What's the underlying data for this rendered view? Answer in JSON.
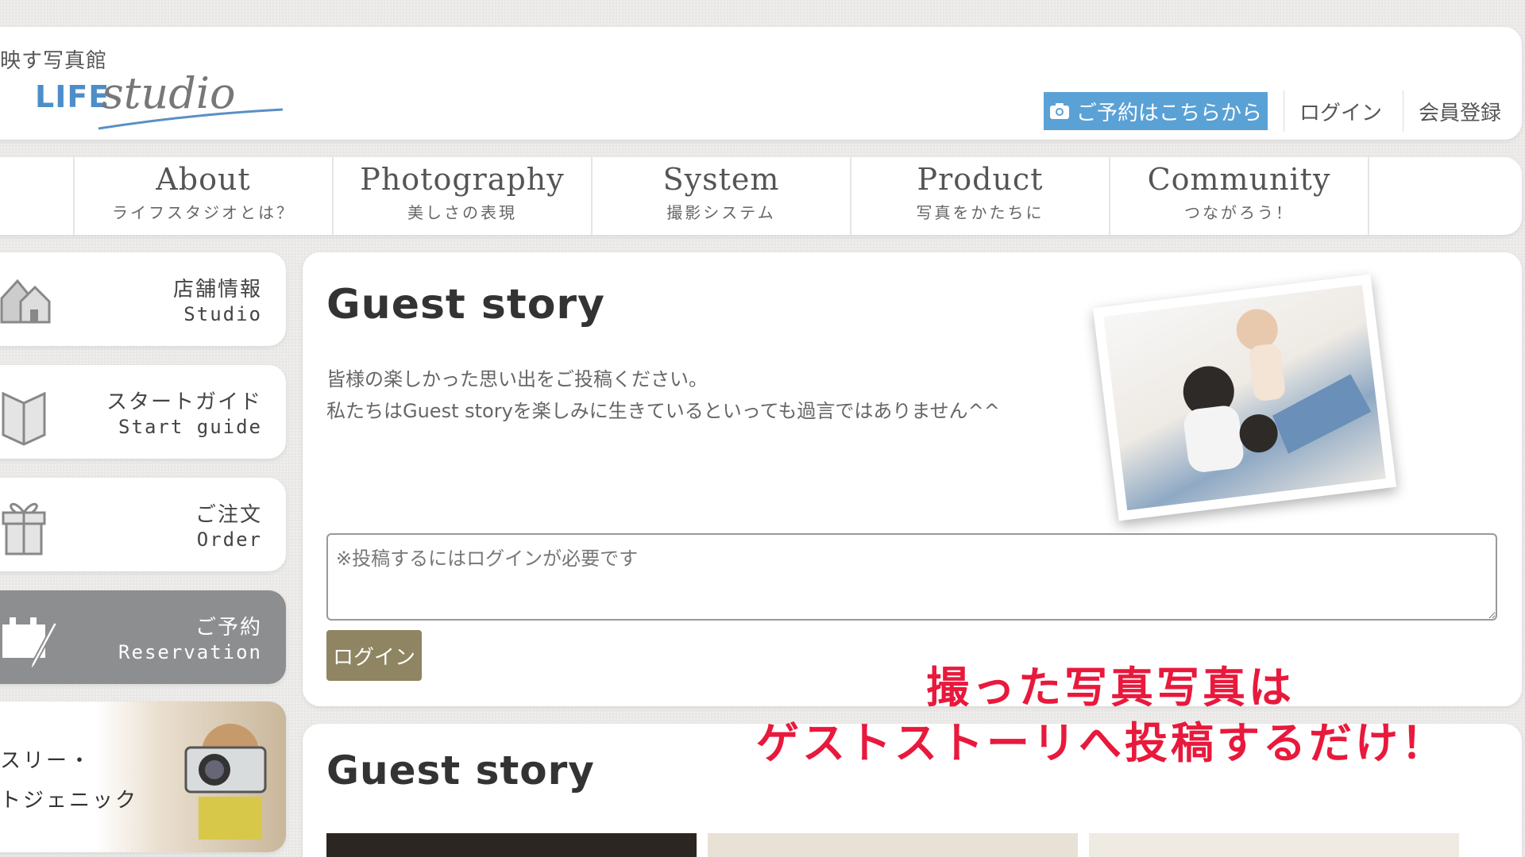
{
  "header": {
    "brand_tagline": "映す写真館",
    "brand_life": "LIFE",
    "brand_script": "studio",
    "reserve_label": "ご予約はこちらから",
    "login_label": "ログイン",
    "register_label": "会員登録"
  },
  "nav": {
    "items": [
      {
        "en": "About",
        "ja": "ライフスタジオとは？"
      },
      {
        "en": "Photography",
        "ja": "美しさの表現"
      },
      {
        "en": "System",
        "ja": "撮影システム"
      },
      {
        "en": "Product",
        "ja": "写真をかたちに"
      },
      {
        "en": "Community",
        "ja": "つながろう！"
      }
    ]
  },
  "sidebar": {
    "items": [
      {
        "ja": "店舗情報",
        "en": "Studio"
      },
      {
        "ja": "スタートガイド",
        "en": "Start guide"
      },
      {
        "ja": "ご注文",
        "en": "Order"
      },
      {
        "ja": "ご予約",
        "en": "Reservation"
      }
    ],
    "photo_line1": "スリー・",
    "photo_line2": "トジェニック"
  },
  "main": {
    "title": "Guest story",
    "desc_line1": "皆様の楽しかった思い出をご投稿ください。",
    "desc_line2": "私たちはGuest storyを楽しみに生きているといっても過言ではありません^^",
    "comment_placeholder": "※投稿するにはログインが必要です",
    "login_button": "ログイン"
  },
  "overlay": {
    "line1": "撮った写真写真は",
    "line2": "ゲストストーリへ投稿するだけ！"
  },
  "section2": {
    "title": "Guest story"
  },
  "colors": {
    "reserve_blue": "#5aa1d6",
    "login_btn": "#8f8562",
    "active_side": "#8d8e90",
    "overlay_red": "#e8193c"
  }
}
